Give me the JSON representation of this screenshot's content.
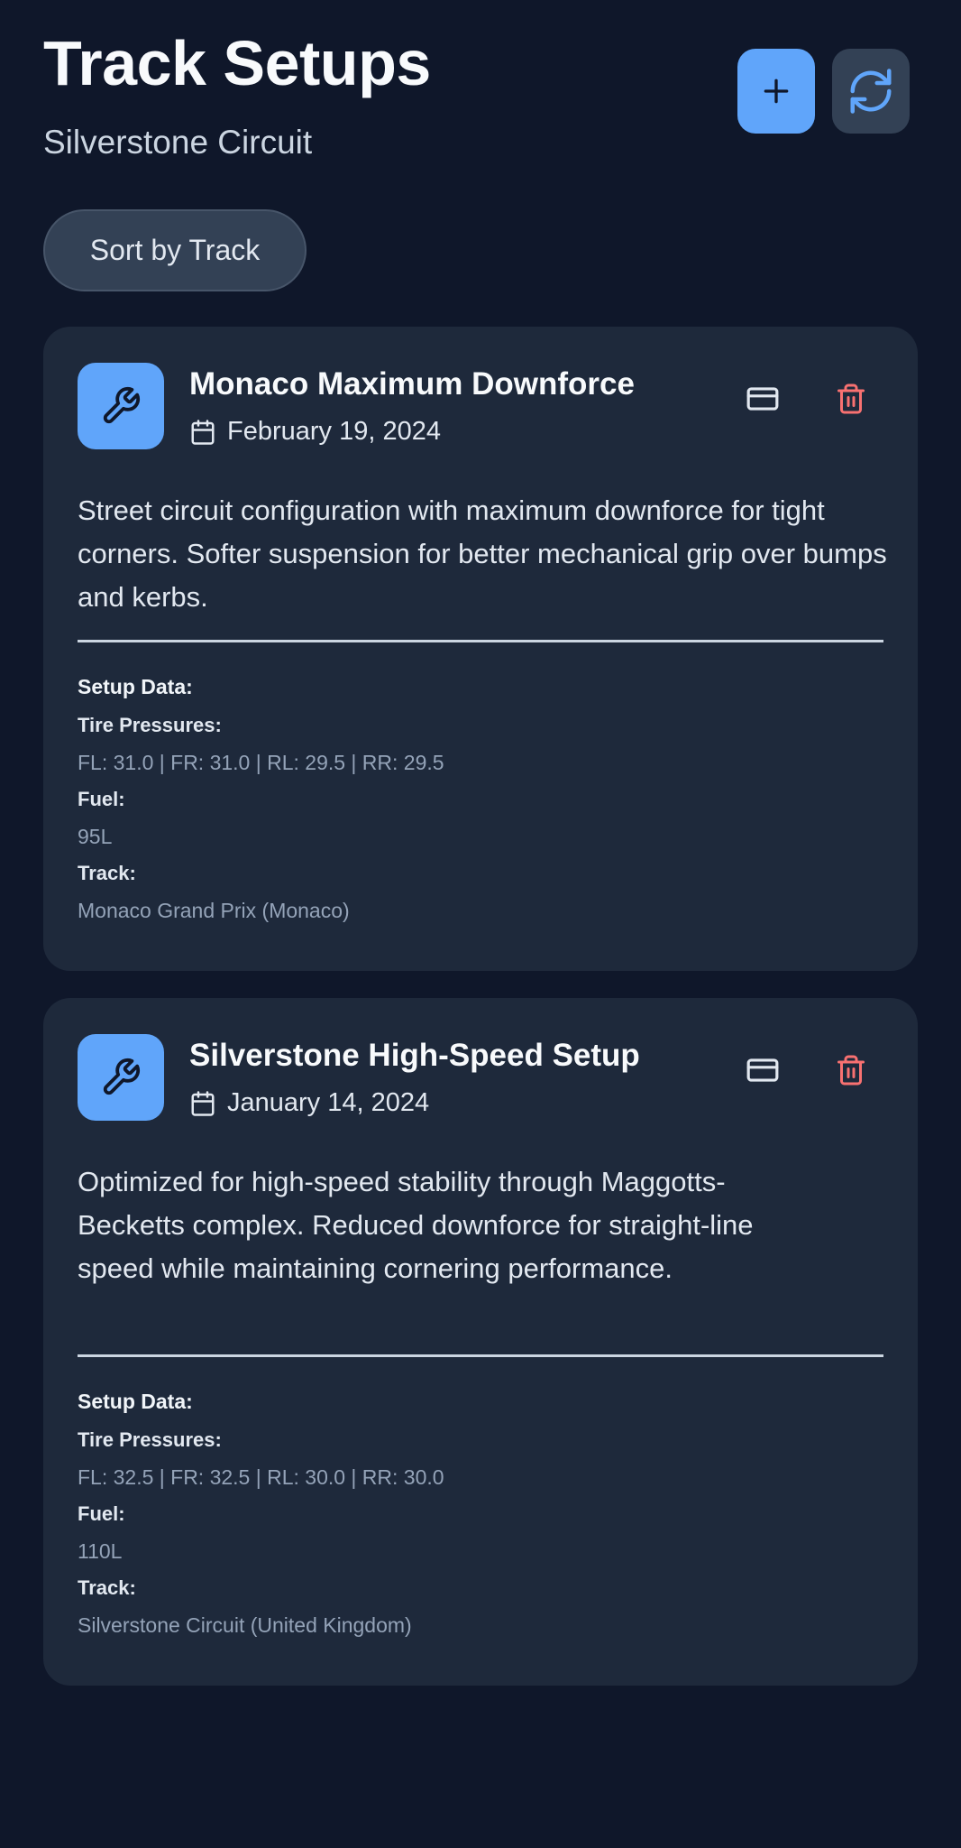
{
  "header": {
    "title": "Track Setups",
    "subtitle": "Silverstone Circuit",
    "add_icon": "plus-icon",
    "refresh_icon": "refresh-icon"
  },
  "sort_button": {
    "label": "Sort by Track"
  },
  "colors": {
    "background": "#0f172a",
    "card": "#1e293b",
    "accent": "#60a5fa",
    "delete": "#f87171",
    "muted_text": "#94a3b8"
  },
  "setups": [
    {
      "title": "Monaco Maximum Downforce",
      "date": "February 19, 2024",
      "description": "Street circuit configuration with maximum downforce for tight corners. Softer suspension for better mechanical grip over bumps and kerbs.",
      "setup_heading": "Setup Data:",
      "tire_label": "Tire Pressures:",
      "tire_value": "FL: 31.0 | FR: 31.0 | RL: 29.5 | RR: 29.5",
      "fuel_label": "Fuel:",
      "fuel_value": "95L",
      "track_label": "Track:",
      "track_value": "Monaco Grand Prix (Monaco)"
    },
    {
      "title": "Silverstone High-Speed Setup",
      "date": "January 14, 2024",
      "description": "Optimized for high-speed stability through Maggotts-Becketts complex. Reduced downforce for straight-line speed while maintaining cornering performance.",
      "setup_heading": "Setup Data:",
      "tire_label": "Tire Pressures:",
      "tire_value": "FL: 32.5 | FR: 32.5 | RL: 30.0 | RR: 30.0",
      "fuel_label": "Fuel:",
      "fuel_value": "110L",
      "track_label": "Track:",
      "track_value": "Silverstone Circuit (United Kingdom)"
    }
  ]
}
